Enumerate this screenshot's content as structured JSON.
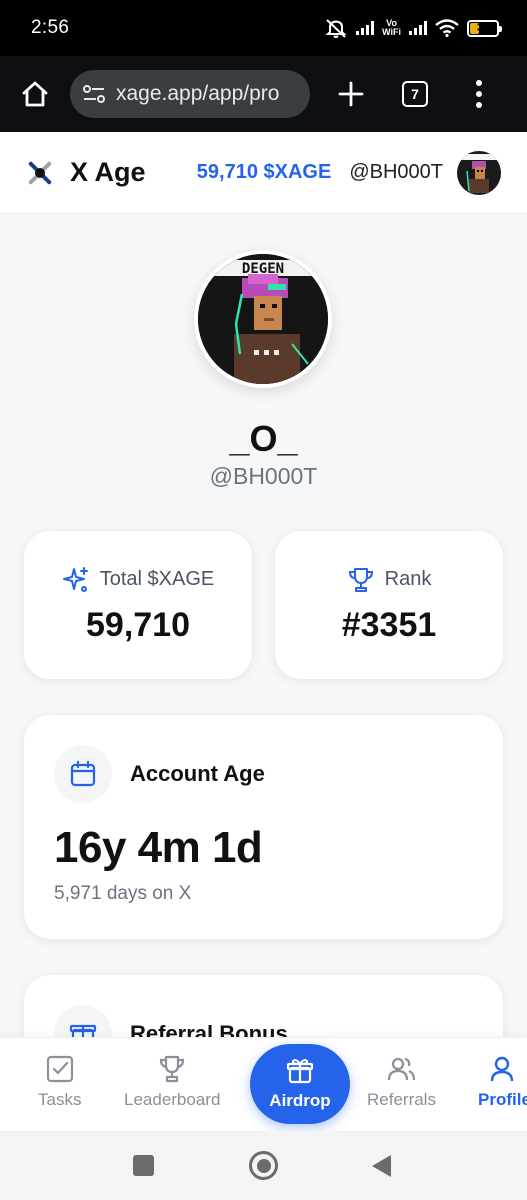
{
  "status_bar": {
    "time": "2:56",
    "vowifi_line1": "Vo",
    "vowifi_line2": "WiFi",
    "battery_level": "38",
    "battery_color": "#e8b10f"
  },
  "browser": {
    "url": "xage.app/app/pro",
    "tab_count": "7"
  },
  "header": {
    "app_name": "X Age",
    "balance": "59,710 $XAGE",
    "handle": "@BH000T"
  },
  "profile": {
    "display_name": "_O_",
    "handle": "@BH000T",
    "avatar_banner_text": "DEGEN"
  },
  "stats": {
    "total_label": "Total $XAGE",
    "total_value": "59,710",
    "rank_label": "Rank",
    "rank_value": "#3351"
  },
  "account_age": {
    "title": "Account Age",
    "value": "16y 4m 1d",
    "subtitle": "5,971 days on X"
  },
  "referral": {
    "title": "Referral Bonus"
  },
  "bottom_nav": {
    "tasks": "Tasks",
    "leaderboard": "Leaderboard",
    "airdrop": "Airdrop",
    "referrals": "Referrals",
    "profile": "Profile"
  },
  "colors": {
    "accent": "#2563eb",
    "muted": "#8b9099"
  }
}
